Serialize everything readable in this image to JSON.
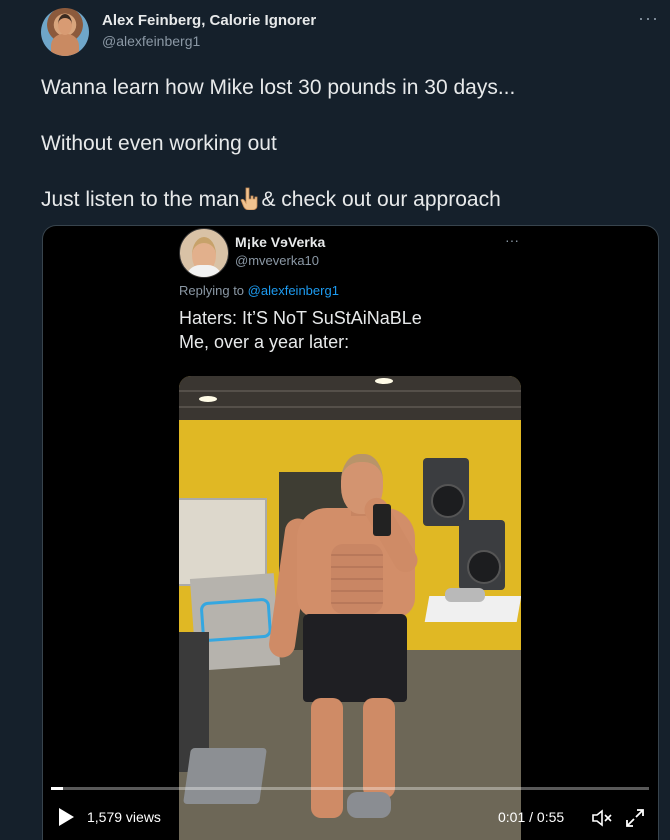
{
  "author": {
    "name": "Alex Feinberg, Calorie Ignorer",
    "handle": "@alexfeinberg1"
  },
  "more_glyph": "···",
  "tweet": {
    "line1": "Wanna learn how Mike lost 30 pounds in 30 days...",
    "line2": "Without even working out",
    "line3_before_emoji": "Just listen to the man",
    "line3_after_emoji": "& check out our approach",
    "emoji_icon": "pointing-down-emoji"
  },
  "embedded": {
    "name": "Mike VeVerka",
    "name_display": "M¡ke VɘVerka",
    "handle": "@mveverka10",
    "more_glyph": "···",
    "replying_prefix": "Replying to",
    "replying_handle": "@alexfeinberg1",
    "text_line1": "Haters: It’S NoT SuStAiNaBLe",
    "text_line2": "Me, over a year later:"
  },
  "video": {
    "views": "1,579 views",
    "time": "0:01 / 0:55",
    "progress": 0.02
  },
  "colors": {
    "background": "#15202b",
    "link": "#1d9bf0",
    "muted": "#8b98a5"
  }
}
